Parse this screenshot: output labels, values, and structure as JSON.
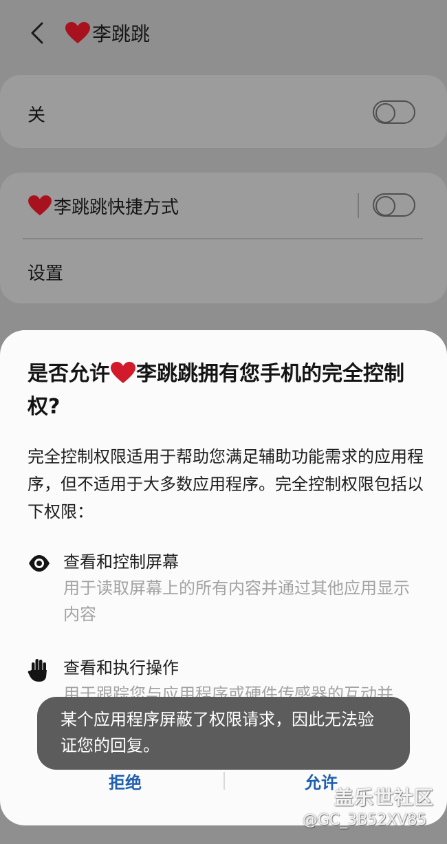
{
  "header": {
    "app_name": "李跳跳"
  },
  "main_switch": {
    "label": "关",
    "state": "off"
  },
  "shortcut": {
    "label": "李跳跳快捷方式",
    "state": "off"
  },
  "settings": {
    "label": "设置"
  },
  "dialog": {
    "title_before": "是否允许",
    "title_after": "李跳跳拥有您手机的完全控制权?",
    "description": "完全控制权限适用于帮助您满足辅助功能需求的应用程序，但不适用于大多数应用程序。完全控制权限包括以下权限：",
    "permissions": [
      {
        "icon": "eye-icon",
        "title": "查看和控制屏幕",
        "description": "用于读取屏幕上的所有内容并通过其他应用显示内容"
      },
      {
        "icon": "hand-icon",
        "title": "查看和执行操作",
        "description": "用于跟踪您与应用程序或硬件传感器的互动并"
      }
    ],
    "deny_label": "拒绝",
    "allow_label": "允许"
  },
  "toast": {
    "message": "某个应用程序屏蔽了权限请求，因此无法验证您的回复。"
  },
  "watermark": {
    "logo": "盖乐世社区",
    "user": "@GC_3B52XV85"
  },
  "colors": {
    "accent": "#1f5fb0",
    "heart": "#d11a2a",
    "toast_bg": "#5c5c5c"
  }
}
